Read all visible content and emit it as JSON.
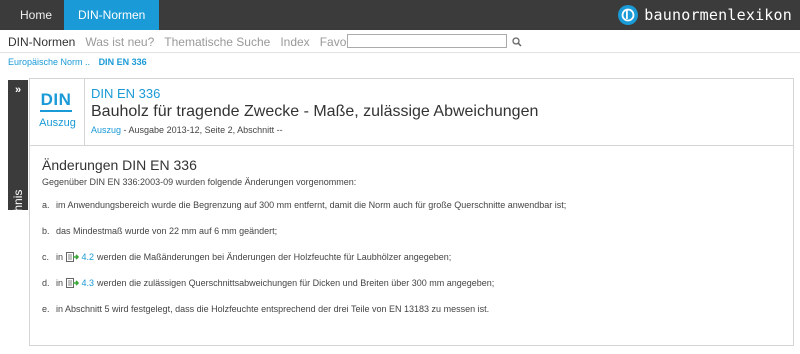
{
  "top_nav": {
    "tabs": [
      {
        "label": "Home"
      },
      {
        "label": "DIN-Normen"
      }
    ],
    "brand": "baunormenlexikon"
  },
  "sub_nav": {
    "items": [
      "DIN-Normen",
      "Was ist neu?",
      "Thematische Suche",
      "Index",
      "Favoriten"
    ],
    "search_value": "",
    "search_placeholder": ""
  },
  "breadcrumb": {
    "parent": "Europäische Norm ..",
    "current": "DIN EN 336"
  },
  "sidetab": {
    "arrow": "»",
    "label": "Inhaltsverzeichnis"
  },
  "doc": {
    "logo_text": "DIN",
    "logo_sub": "Auszug",
    "number": "DIN EN 336",
    "title": "Bauholz für tragende Zwecke - Maße, zulässige Abweichungen",
    "meta_link": "Auszug",
    "meta_rest": " - Ausgabe 2013-12, Seite 2, Abschnitt --"
  },
  "changes": {
    "title": "Änderungen DIN EN 336",
    "intro": "Gegenüber DIN EN 336:2003-09 wurden folgende Änderungen vorgenommen:",
    "items": [
      {
        "letter": "a.",
        "text": "im Anwendungsbereich wurde die Begrenzung auf 300 mm entfernt, damit die Norm auch für große Querschnitte anwendbar ist;"
      },
      {
        "letter": "b.",
        "text": "das Mindestmaß wurde von 22 mm auf 6 mm geändert;"
      },
      {
        "letter": "c.",
        "pre": "in",
        "ref": "4.2",
        "text": "werden die Maßänderungen bei Änderungen der Holzfeuchte für Laubhölzer angegeben;"
      },
      {
        "letter": "d.",
        "pre": "in",
        "ref": "4.3",
        "text": "werden die zulässigen Querschnittsabweichungen für Dicken und Breiten über 300 mm angegeben;"
      },
      {
        "letter": "e.",
        "text": "in Abschnitt 5 wird festgelegt, dass die Holzfeuchte entsprechend der drei Teile von EN 13183 zu messen ist."
      }
    ]
  },
  "colors": {
    "accent": "#1a9ad6",
    "topbar": "#3b3b3b"
  }
}
